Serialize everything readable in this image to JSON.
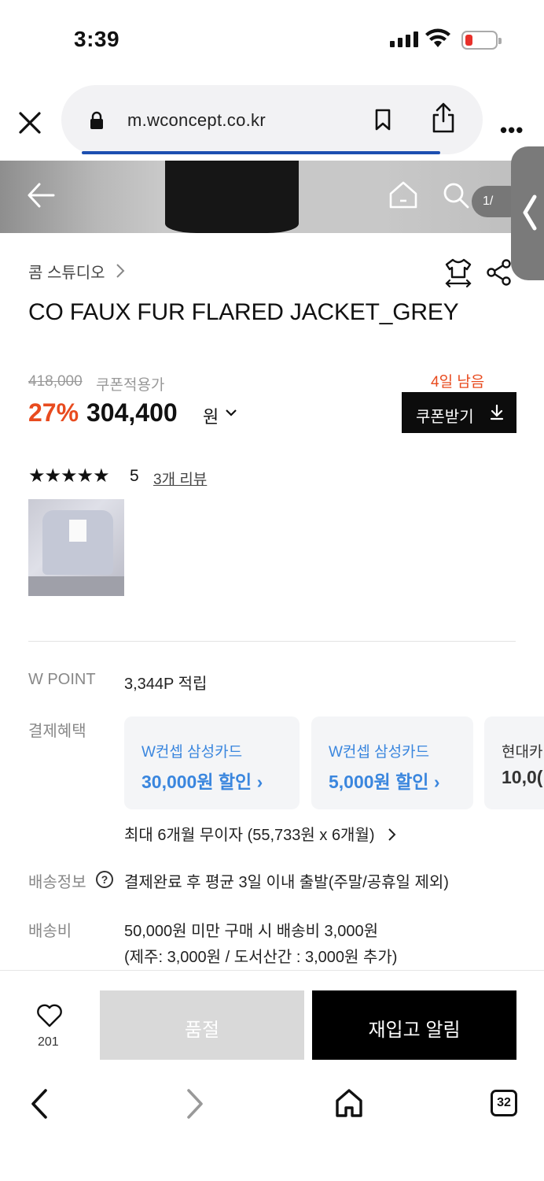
{
  "status_bar": {
    "time": "3:39"
  },
  "browser": {
    "url": "m.wconcept.co.kr",
    "tab_count": "32"
  },
  "hero": {
    "image_counter": "1/"
  },
  "product": {
    "brand": "콤 스튜디오",
    "title": "CO FAUX FUR FLARED JACKET_GREY",
    "original_price": "418,000",
    "coupon_price_label": "쿠폰적용가",
    "discount_rate": "27%",
    "price": "304,400",
    "currency": "원",
    "coupon_days_left": "4일 남음",
    "coupon_button": "쿠폰받기",
    "stars": "★★★★★",
    "rating": "5",
    "review_link": "3개 리뷰"
  },
  "details": {
    "wpoint_label": "W POINT",
    "wpoint_value": "3,344P 적립",
    "payment_label": "결제혜택",
    "cards": [
      {
        "name": "W컨셉 삼성카드",
        "benefit": "30,000원 할인 ›"
      },
      {
        "name": "W컨셉 삼성카드",
        "benefit": "5,000원 할인 ›"
      },
      {
        "name": "현대카",
        "benefit": "10,0("
      }
    ],
    "installment": "최대 6개월 무이자 (55,733원 x 6개월)",
    "shipping_info_label": "배송정보",
    "shipping_info_value": "결제완료 후 평균 3일 이내 출발(주말/공휴일 제외)",
    "shipping_fee_label": "배송비",
    "shipping_fee_line1": "50,000원 미만 구매 시 배송비 3,000원",
    "shipping_fee_line2": "(제주: 3,000원 / 도서산간 : 3,000원 추가)"
  },
  "actions": {
    "like_count": "201",
    "soldout": "품절",
    "restock_alert": "재입고 알림"
  },
  "colors": {
    "accent_red": "#e84b1f",
    "card_blue": "#3a86de",
    "black": "#000000"
  }
}
